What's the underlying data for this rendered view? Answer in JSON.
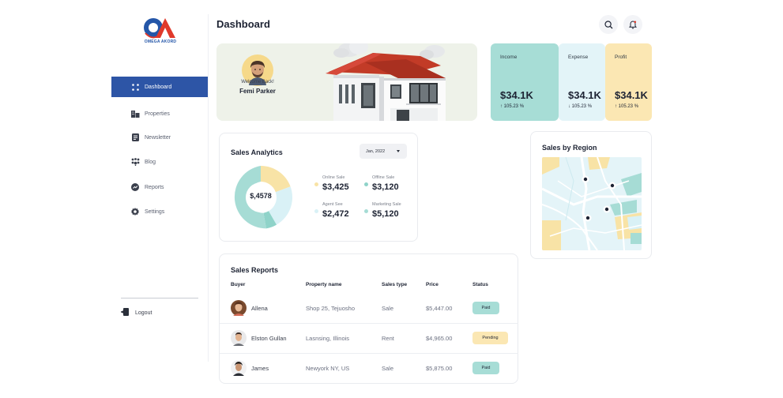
{
  "brand": {
    "name": "OMEGA AKORD"
  },
  "sidebar": {
    "items": [
      {
        "label": "Dashboard",
        "icon": "grid-icon",
        "active": true
      },
      {
        "label": "Properties",
        "icon": "building-icon"
      },
      {
        "label": "Newsletter",
        "icon": "newsletter-icon"
      },
      {
        "label": "Blog",
        "icon": "blog-icon"
      },
      {
        "label": "Reports",
        "icon": "reports-icon"
      },
      {
        "label": "Settings",
        "icon": "gear-icon"
      }
    ],
    "logout_label": "Logout"
  },
  "header": {
    "title": "Dashboard"
  },
  "welcome": {
    "greeting": "Welcome Back!",
    "name": "Femi Parker"
  },
  "stats": [
    {
      "label": "Income",
      "value": "$34.1K",
      "change": "105.23 %",
      "direction": "up",
      "color": "#a7ddd6"
    },
    {
      "label": "Expense",
      "value": "$34.1K",
      "change": "105.23 %",
      "direction": "down",
      "color": "#e3f4f8"
    },
    {
      "label": "Profit",
      "value": "$34.1K",
      "change": "105.23 %",
      "direction": "up",
      "color": "#fbe7b3"
    }
  ],
  "analytics": {
    "title": "Sales Analytics",
    "period": "Jan, 2022",
    "total": "$,4578",
    "legend": [
      {
        "label": "Online Sale",
        "value": "$3,425",
        "color": "#f8e3a6"
      },
      {
        "label": "Offline Sale",
        "value": "$3,120",
        "color": "#8fd3c9"
      },
      {
        "label": "Agent See",
        "value": "$2,472",
        "color": "#d9f1f6"
      },
      {
        "label": "Marketing Sale",
        "value": "$5,120",
        "color": "#a6dcd5"
      }
    ]
  },
  "region": {
    "title": "Sales by Region"
  },
  "reports": {
    "title": "Sales Reports",
    "columns": [
      "Buyer",
      "Property name",
      "Sales type",
      "Price",
      "Status"
    ],
    "rows": [
      {
        "buyer": "Allena",
        "property": "Shop 25, Tejuosho",
        "type": "Sale",
        "price": "$5,447.00",
        "status": "Paid"
      },
      {
        "buyer": "Elston Gullan",
        "property": "Lasnsing, Illinois",
        "type": "Rent",
        "price": "$4,965.00",
        "status": "Pending"
      },
      {
        "buyer": "James",
        "property": "Newyork NY, US",
        "type": "Sale",
        "price": "$5,875.00",
        "status": "Paid"
      }
    ]
  },
  "colors": {
    "primary": "#2d55a6",
    "paid": "#a7ddd6",
    "pending": "#fbe7b3"
  }
}
